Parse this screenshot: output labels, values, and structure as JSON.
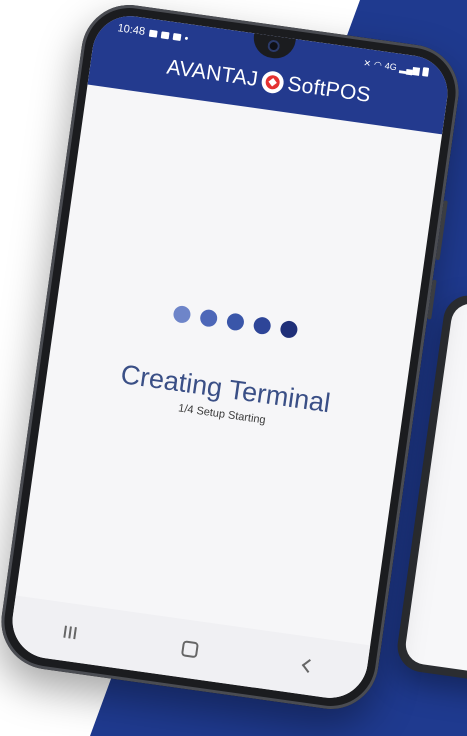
{
  "status_bar": {
    "time": "10:48",
    "signal_text": "4G"
  },
  "app_header": {
    "brand_left": "AVANTAJ",
    "brand_right": "SoftPOS"
  },
  "loader": {
    "dot_colors": [
      "#6e85c9",
      "#4d67b8",
      "#3a56a9",
      "#2e4598",
      "#1f2f78"
    ]
  },
  "status": {
    "title": "Creating Terminal",
    "subtitle": "1/4 Setup Starting"
  },
  "colors": {
    "brand_blue": "#233a8e",
    "accent_red": "#e43131",
    "background_band": "#1f3a8f"
  }
}
